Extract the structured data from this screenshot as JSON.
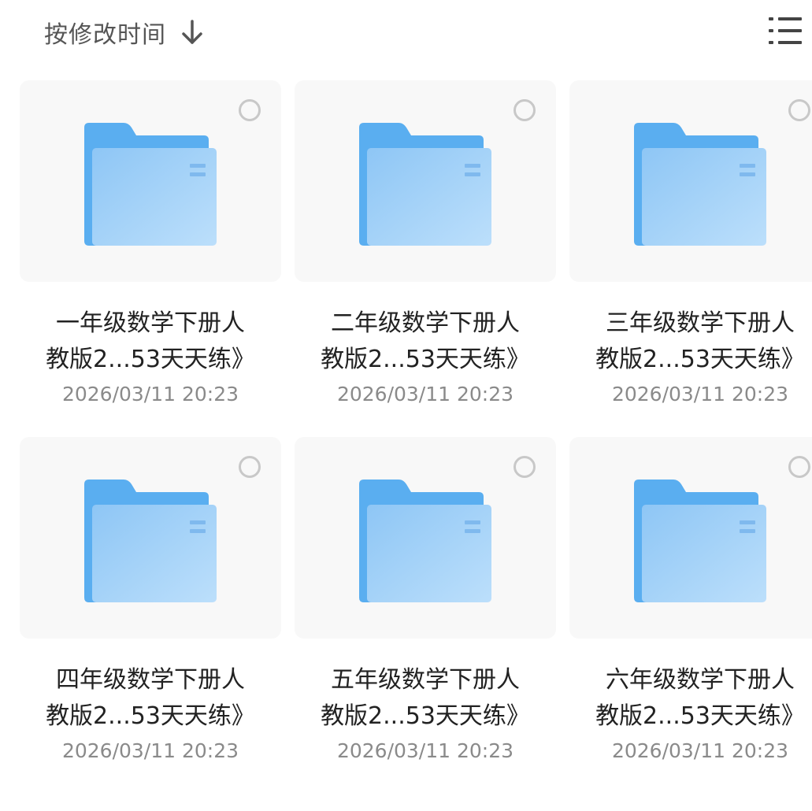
{
  "toolbar": {
    "sort_label": "按修改时间",
    "sort_icon": "arrow-down-icon",
    "view_icon": "list-view-icon"
  },
  "colors": {
    "folder_back": "#5aaef0",
    "folder_front_top": "#8fc7f6",
    "folder_front_bottom": "#b8dcfa",
    "card_bg": "#f8f8f8",
    "date_text": "#8a8a8a"
  },
  "folders": [
    {
      "name": "一年级数学下册人\n教版2...53天天练》",
      "date": "2026/03/11 20:23"
    },
    {
      "name": "二年级数学下册人\n教版2...53天天练》",
      "date": "2026/03/11 20:23"
    },
    {
      "name": "三年级数学下册人\n教版2...53天天练》",
      "date": "2026/03/11 20:23"
    },
    {
      "name": "四年级数学下册人\n教版2...53天天练》",
      "date": "2026/03/11 20:23"
    },
    {
      "name": "五年级数学下册人\n教版2...53天天练》",
      "date": "2026/03/11 20:23"
    },
    {
      "name": "六年级数学下册人\n教版2...53天天练》",
      "date": "2026/03/11 20:23"
    }
  ]
}
